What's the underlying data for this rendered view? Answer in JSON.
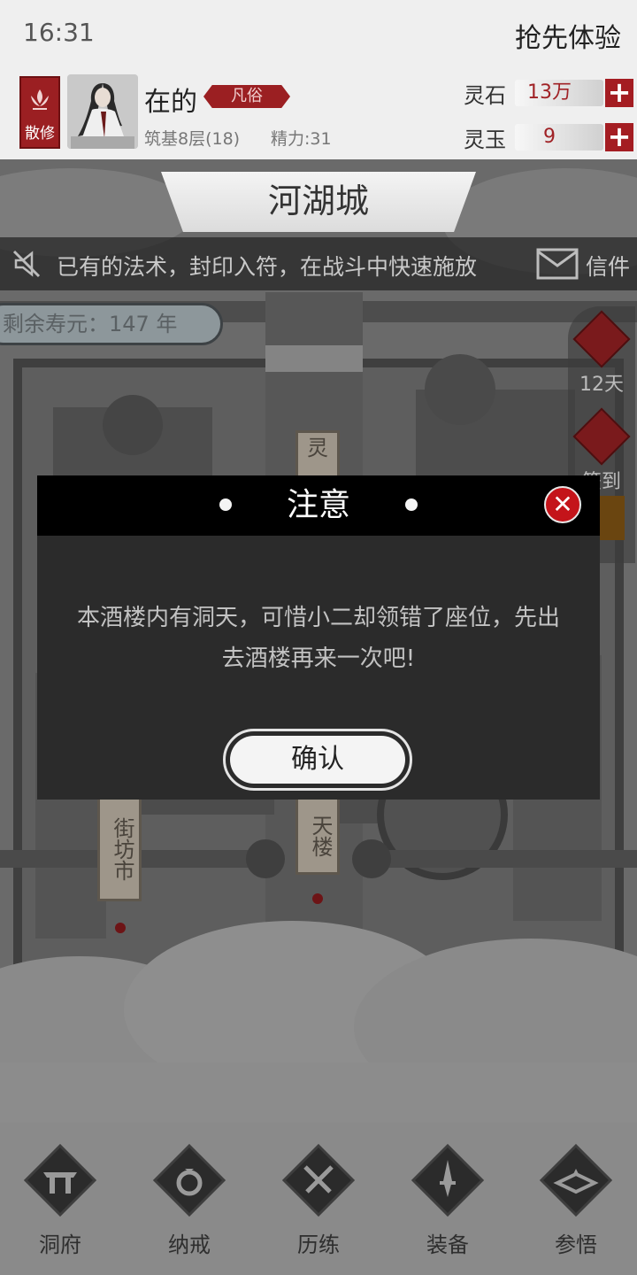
{
  "status_bar": {
    "time": "16:31",
    "early_access": "抢先体验"
  },
  "player": {
    "sect_label": "散修",
    "name": "在的",
    "rank": "凡俗",
    "realm_level": "筑基8层(18)",
    "stamina": "精力:31"
  },
  "currencies": [
    {
      "name": "灵石",
      "value": "13万"
    },
    {
      "name": "灵玉",
      "value": "9"
    }
  ],
  "map": {
    "city_name": "河湖城",
    "notice": "已有的法术，封印入符，在战斗中快速施放",
    "mail_label": "信件",
    "lifespan": "剩余寿元：147 年",
    "side_menu": [
      {
        "icon": "token-icon",
        "label": "12天"
      },
      {
        "icon": "sign-in-icon",
        "label": "签到"
      }
    ],
    "locations": [
      {
        "label": "灵"
      },
      {
        "label": "街坊市"
      },
      {
        "label": "天楼"
      }
    ]
  },
  "bottom_nav": [
    {
      "icon": "cave-icon",
      "label": "洞府"
    },
    {
      "icon": "ring-icon",
      "label": "纳戒"
    },
    {
      "icon": "swords-icon",
      "label": "历练"
    },
    {
      "icon": "dagger-icon",
      "label": "装备"
    },
    {
      "icon": "book-icon",
      "label": "参悟"
    }
  ],
  "modal": {
    "title": "注意",
    "message": "本酒楼内有洞天，可惜小二却领错了座位，先出去酒楼再来一次吧!",
    "confirm_label": "确认"
  },
  "colors": {
    "accent_red": "#9b1f22",
    "modal_bg": "#2b2b2b",
    "header_bg": "#000000"
  }
}
